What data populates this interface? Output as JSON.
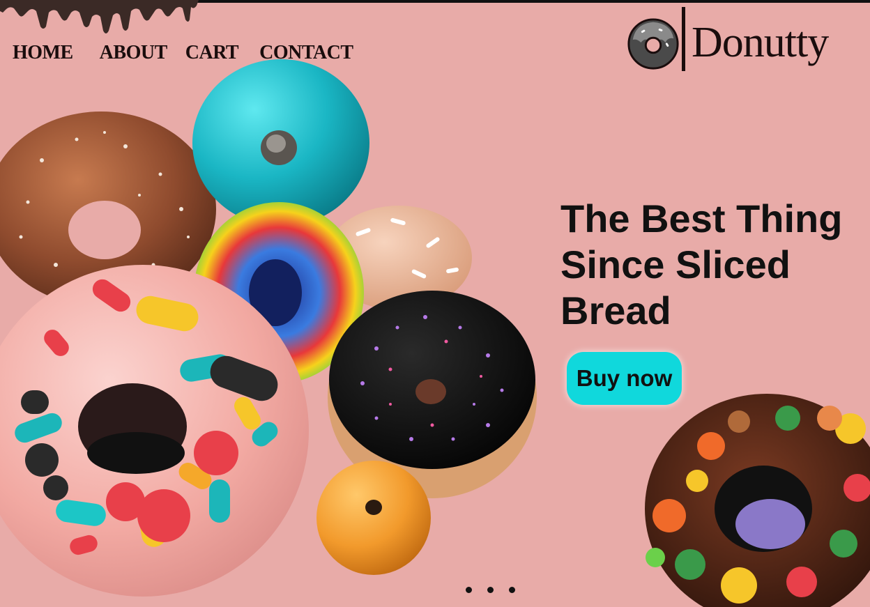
{
  "nav": {
    "items": [
      {
        "label": "HOME"
      },
      {
        "label": "ABOUT"
      },
      {
        "label": "CART"
      },
      {
        "label": "CONTACT"
      }
    ]
  },
  "brand": {
    "name": "Donutty",
    "logo_icon": "donut-icon"
  },
  "hero": {
    "headline": "The Best Thing Since Sliced Bread",
    "cta_label": "Buy now"
  },
  "carousel": {
    "slide_count": 3
  },
  "colors": {
    "background": "#e8aba8",
    "accent": "#10d8dc",
    "text": "#111111",
    "chocolate": "#3b2a26"
  }
}
